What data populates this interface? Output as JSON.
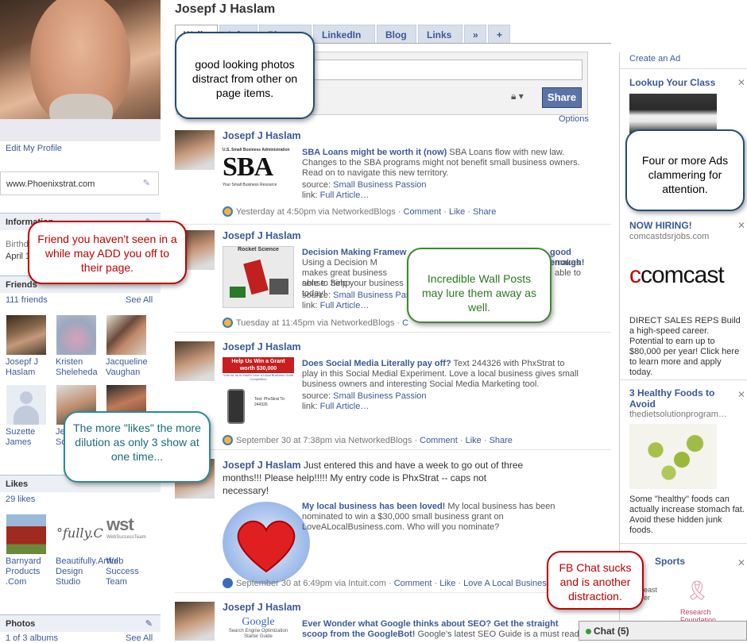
{
  "left": {
    "edit_profile": "Edit My Profile",
    "website": "www.Phoenixstrat.com",
    "info_head": "Information",
    "info_birth_label": "Birthd",
    "info_birth_value": "April 1",
    "friends_head": "Friends",
    "friends_count": "111 friends",
    "see_all": "See All",
    "friends": [
      {
        "name": "Josepf J Haslam"
      },
      {
        "name": "Kristen Sheleheda"
      },
      {
        "name": "Jacqueline Vaughan"
      },
      {
        "name": "Suzette James"
      },
      {
        "name": "Je"
      },
      {
        "name": "So"
      }
    ],
    "likes_head": "Likes",
    "likes_count": "29 likes",
    "likes": [
      {
        "name": "Barnyard Products .Com"
      },
      {
        "name": "Beautifully.Artful Design Studio"
      },
      {
        "name": "Web Success Team"
      }
    ],
    "photos_head": "Photos",
    "photos_count": "1 of 3 albums",
    "photos_see_all": "See All"
  },
  "header": {
    "name": "Josepf J Haslam",
    "tabs": [
      "Wall",
      "Info",
      "Photos",
      "LinkedIn",
      "Blog",
      "Links",
      "»",
      "+"
    ]
  },
  "publisher": {
    "share": "Share",
    "options": "Options"
  },
  "posts": [
    {
      "name": "Josepf J Haslam",
      "title": "SBA Loans might be worth it (now)",
      "text": " SBA Loans flow with new law. Changes to the SBA programs might not benefit small business owners. Read on to navigate this new territory.",
      "source_label": "source: ",
      "source": "Small Business Passion",
      "link_label": "link: ",
      "link": "Full Article…",
      "meta": "Yesterday at 4:50pm via NetworkedBlogs",
      "actions": [
        "Comment",
        "Like",
        "Share"
      ],
      "img_brand": "SBA",
      "img_top": "U.S. Small Business Administration",
      "img_bottom": "Your Small Business Resource"
    },
    {
      "name": "Josepf J Haslam",
      "title": "Decision Making Framew",
      "title_end": "good enough!",
      "text": " Using a Decision M",
      "text2": "makes great business sense. Simp",
      "text3": "able to help your business today!",
      "source_label": "source: ",
      "source": "Small Business Pass",
      "link_label": "link: ",
      "link": "Full Article…",
      "meta": "Tuesday at 11:45pm via NetworkedBlogs",
      "img_caption": "Rocket Science"
    },
    {
      "name": "Josepf J Haslam",
      "title": "Does Social Media Literally pay off?",
      "text": " Text 244326 with PhxStrat to play in this Social Medial Experiment. Love a local business gives small business owners and interesting Social Media Marketing tool.",
      "source_label": "source: ",
      "source": "Small Business Passion",
      "link_label": "link: ",
      "link": "Full Article…",
      "meta": "September 30 at 7:38pm via NetworkedBlogs",
      "actions": [
        "Comment",
        "Like",
        "Share"
      ],
      "img_line1": "Help Us Win a Grant worth $30,000",
      "img_line2": "Vote for us in Intuit's Love a Local Business Grant Competition",
      "img_line3": "Text: PhxStrat To: 244326"
    },
    {
      "name": "Josepf J Haslam",
      "status": " Just entered this and have a week to go out of three months!!! Please help!!!!! My entry code is PhxStrat -- caps not necessary!",
      "title": "My local business has been loved!",
      "text": " My local business has been nominated to win a $30,000 small business grant on LoveALocalBusiness.com. Who will you nominate?",
      "meta": "September 30 at 6:49pm via Intuit.com",
      "actions": [
        "Comment",
        "Like",
        "Love A Local Business"
      ]
    },
    {
      "name": "Josepf J Haslam",
      "title": "Ever Wonder what Google thinks about SEO? Get the straight scoop from the GoogleBot!",
      "text": " Google's latest SEO Guide is a must read",
      "img_brand": "Google",
      "img_sub": "Search Engine Optimization Starter Guide"
    }
  ],
  "ads": {
    "create": "Create an Ad",
    "items": [
      {
        "title": "Lookup Your Class"
      },
      {
        "title": "NOW HIRING!",
        "sub": "comcastdsrjobs.com",
        "brand": "comcast",
        "text": "DIRECT SALES REPS Build a high-speed career. Potential to earn up to $80,000 per year! Click here to learn more and apply today."
      },
      {
        "title": "3 Healthy Foods to Avoid",
        "sub": "thedietsolutionprogram…",
        "text": "Some \"healthy\" foods can actually increase stomach fat. Avoid these hidden junk foods."
      },
      {
        "title": "Sports",
        "brand_line1": "east",
        "brand_line2": "er",
        "brand_line3": "Research",
        "brand_line4": "Foundation."
      }
    ]
  },
  "callouts": {
    "photos": "good looking photos distract from other on page items.",
    "ads": "Four or more Ads clammering for attention.",
    "friend": "Friend you haven't seen in a while may ADD you off to their page.",
    "wall": "Incredible Wall Posts may lure them away as well.",
    "likes": "The more \"likes\" the more dilution as only 3 show at one time...",
    "chat": "FB Chat sucks and is another distraction."
  },
  "chat": {
    "label": "Chat (5)"
  },
  "colors": {
    "link": "#3b5998",
    "share_bg": "#5b74a8",
    "header_bg": "#eceff5",
    "red": "#c00000",
    "green": "#3a8a2e",
    "navy": "#1f4e79",
    "teal": "#2a8a9a"
  }
}
